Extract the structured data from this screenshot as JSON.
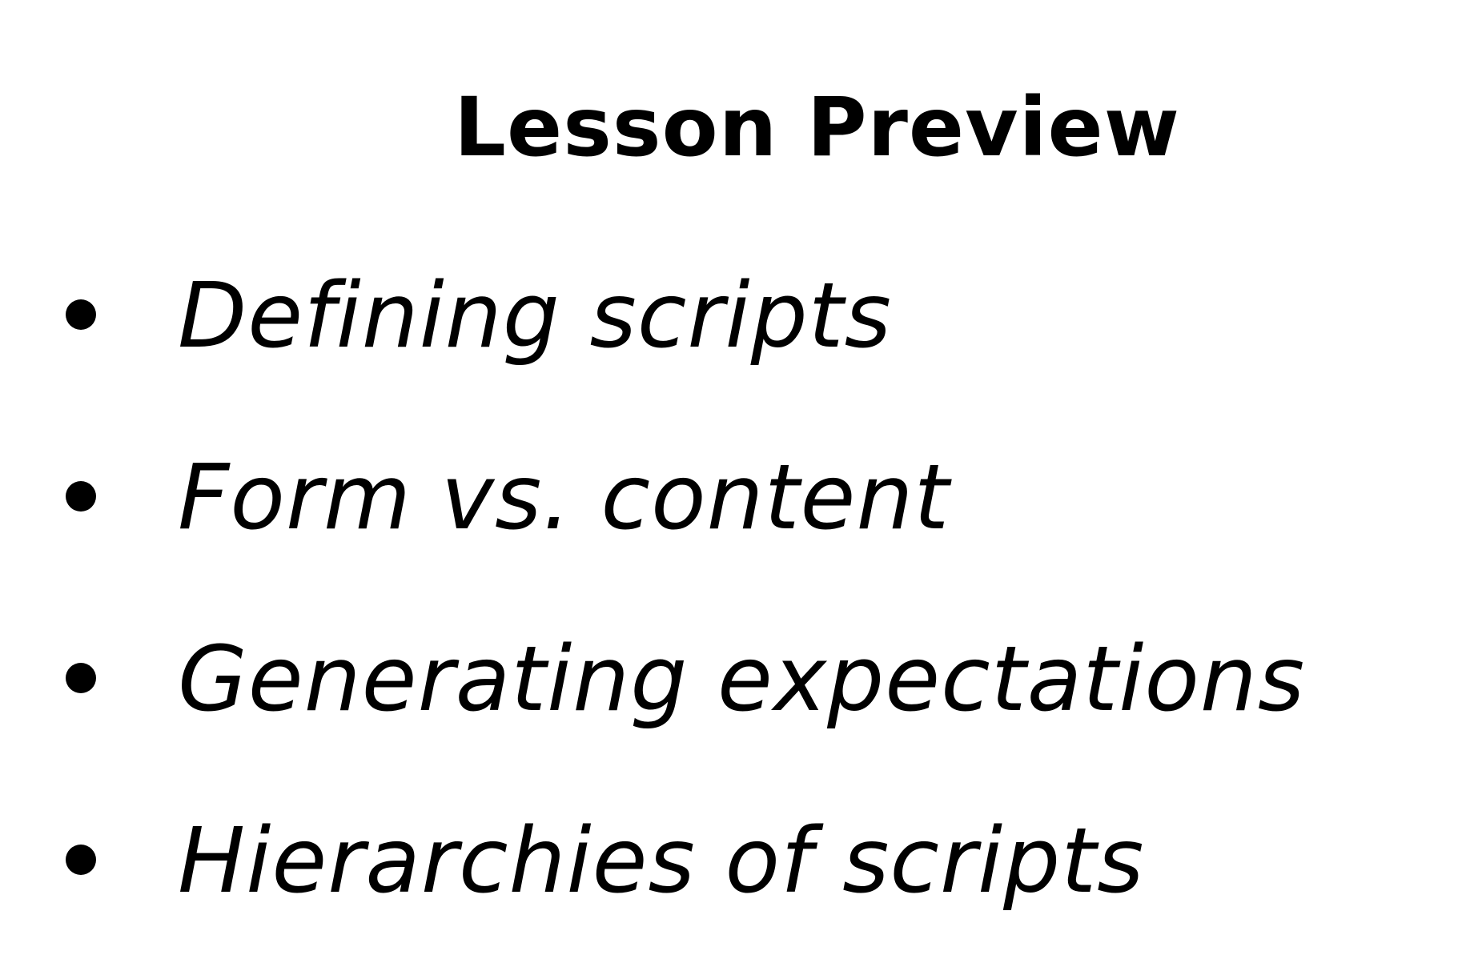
{
  "slide": {
    "title": "Lesson Preview",
    "bullets": [
      {
        "label": "Defining scripts"
      },
      {
        "label": "Form vs. content"
      },
      {
        "label": "Generating expectations"
      },
      {
        "label": "Hierarchies of scripts"
      }
    ]
  },
  "colors": {
    "background": "#ffffff",
    "text": "#000000"
  }
}
